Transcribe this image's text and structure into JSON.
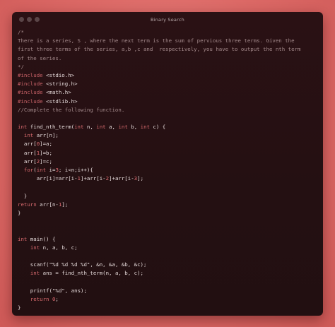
{
  "window": {
    "title": "Binary Search"
  },
  "code_lines": [
    "/*",
    "There is a series, S , where the next term is the sum of pervious three terms. Given the",
    "first three terms of the series, a,b ,c and  respectively, you have to output the nth term",
    "of the series.",
    "*/",
    "#include <stdio.h>",
    "#include <string.h>",
    "#include <math.h>",
    "#include <stdlib.h>",
    "//Complete the following function.",
    "",
    "int find_nth_term(int n, int a, int b, int c) {",
    "  int arr[n];",
    "  arr[0]=a;",
    "  arr[1]=b;",
    "  arr[2]=c;",
    "  for(int i=3; i<n;i++){",
    "      arr[i]=arr[i-1]+arr[i-2]+arr[i-3];",
    "",
    "  }",
    "return arr[n-1];",
    "}",
    "",
    "",
    "int main() {",
    "    int n, a, b, c;",
    "",
    "    scanf(\"%d %d %d %d\", &n, &a, &b, &c);",
    "    int ans = find_nth_term(n, a, b, c);",
    "",
    "    printf(\"%d\", ans);",
    "    return 0;",
    "}"
  ],
  "colors": {
    "background": "#dc6966",
    "window": "#241012",
    "comment": "#a3898b",
    "preprocessor": "#c86167",
    "keyword": "#d86a6e",
    "text": "#e7dcdc"
  }
}
